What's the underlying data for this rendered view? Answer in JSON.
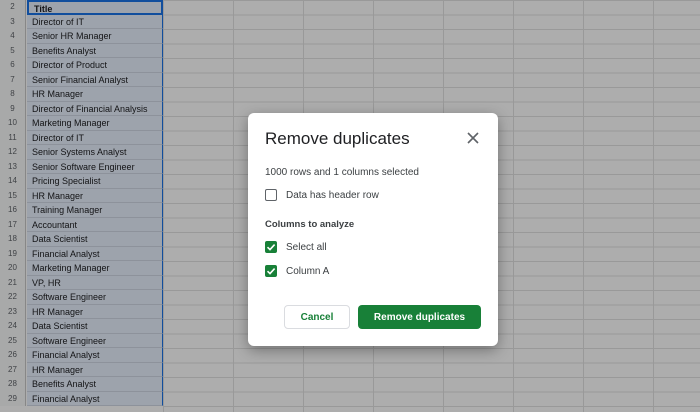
{
  "sheet": {
    "column_header": "Title",
    "rows": [
      {
        "num": "2",
        "value": "Title"
      },
      {
        "num": "3",
        "value": "Director of IT"
      },
      {
        "num": "4",
        "value": "Senior HR Manager"
      },
      {
        "num": "5",
        "value": "Benefits Analyst"
      },
      {
        "num": "6",
        "value": "Director of Product"
      },
      {
        "num": "7",
        "value": "Senior Financial Analyst"
      },
      {
        "num": "8",
        "value": "HR Manager"
      },
      {
        "num": "9",
        "value": "Director of Financial Analysis"
      },
      {
        "num": "10",
        "value": "Marketing Manager"
      },
      {
        "num": "11",
        "value": "Director of IT"
      },
      {
        "num": "12",
        "value": "Senior Systems Analyst"
      },
      {
        "num": "13",
        "value": "Senior Software Engineer"
      },
      {
        "num": "14",
        "value": "Pricing Specialist"
      },
      {
        "num": "15",
        "value": "HR Manager"
      },
      {
        "num": "16",
        "value": "Training Manager"
      },
      {
        "num": "17",
        "value": "Accountant"
      },
      {
        "num": "18",
        "value": "Data Scientist"
      },
      {
        "num": "19",
        "value": "Financial Analyst"
      },
      {
        "num": "20",
        "value": "Marketing Manager"
      },
      {
        "num": "21",
        "value": "VP, HR"
      },
      {
        "num": "22",
        "value": "Software Engineer"
      },
      {
        "num": "23",
        "value": "HR Manager"
      },
      {
        "num": "24",
        "value": "Data Scientist"
      },
      {
        "num": "25",
        "value": "Software Engineer"
      },
      {
        "num": "26",
        "value": "Financial Analyst"
      },
      {
        "num": "27",
        "value": "HR Manager"
      },
      {
        "num": "28",
        "value": "Benefits Analyst"
      },
      {
        "num": "29",
        "value": "Financial Analyst"
      }
    ]
  },
  "dialog": {
    "title": "Remove duplicates",
    "summary": "1000 rows and 1 columns selected",
    "header_row_label": "Data has header row",
    "header_row_checked": false,
    "columns_section": "Columns to analyze",
    "select_all_label": "Select all",
    "select_all_checked": true,
    "column_a_label": "Column A",
    "column_a_checked": true,
    "cancel_label": "Cancel",
    "confirm_label": "Remove duplicates"
  },
  "colors": {
    "accent": "#188038",
    "selection": "#1a73e8"
  }
}
